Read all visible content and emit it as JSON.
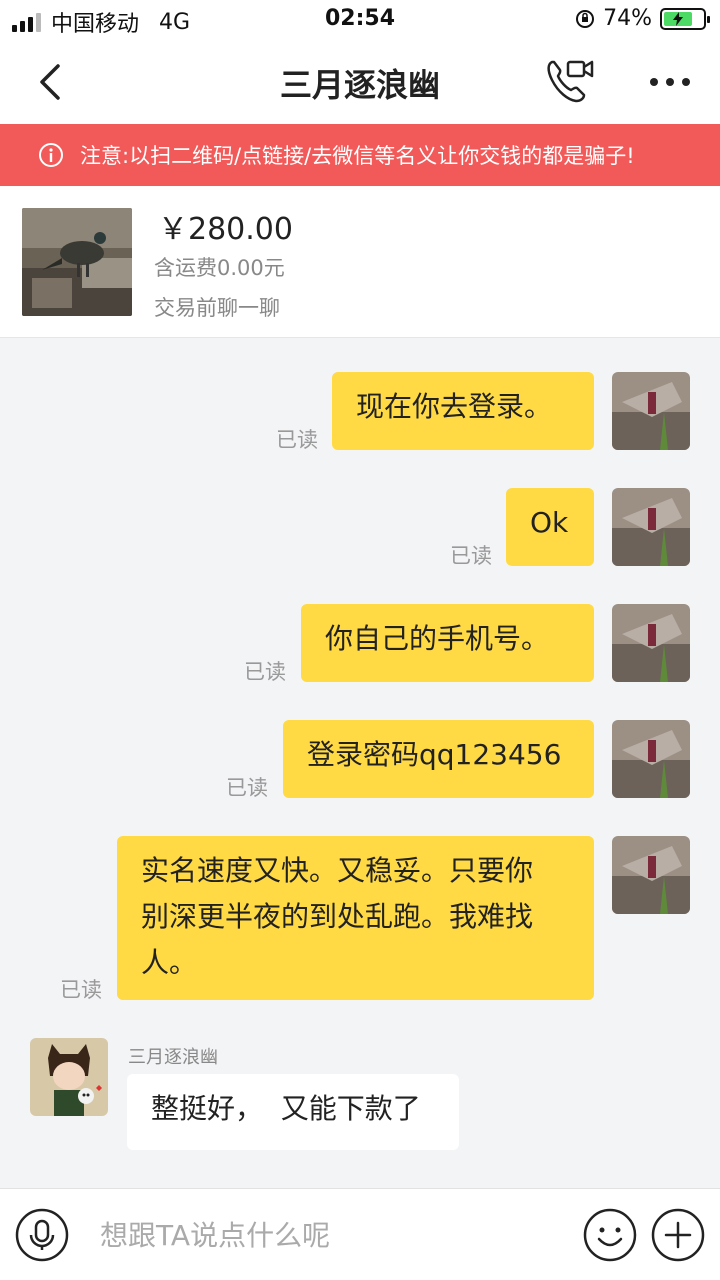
{
  "status_bar": {
    "carrier": "中国移动",
    "network": "4G",
    "time": "02:54",
    "battery": "74%",
    "battery_level": 0.74
  },
  "header": {
    "title": "三月逐浪幽",
    "back_icon": "chevron-left-icon",
    "call_icon": "video-phone-icon",
    "more_icon": "more-dots-icon"
  },
  "warning": {
    "text": "注意:以扫二维码/点链接/去微信等名义让你交钱的都是骗子!",
    "color": "#f25a5a"
  },
  "product": {
    "price": "￥280.00",
    "shipping": "含运费0.00元",
    "note": "交易前聊一聊"
  },
  "messages": [
    {
      "side": "self",
      "text": "现在你去登录。",
      "status": "已读"
    },
    {
      "side": "self",
      "text": "Ok",
      "status": "已读"
    },
    {
      "side": "self",
      "text": "你自己的手机号。",
      "status": "已读"
    },
    {
      "side": "self",
      "text": "登录密码qq123456",
      "status": "已读"
    },
    {
      "side": "self",
      "text_lines": [
        "实名速度又快。又稳妥。只要你",
        "别深更半夜的到处乱跑。我难找",
        "人。"
      ],
      "status": "已读"
    },
    {
      "side": "other",
      "sender": "三月逐浪幽",
      "text": "整挺好，  又能下款了"
    }
  ],
  "input_bar": {
    "placeholder": "想跟TA说点什么呢",
    "mic_icon": "microphone-icon",
    "emoji_icon": "smiley-icon",
    "plus_icon": "plus-icon"
  },
  "colors": {
    "bubble_self": "#ffda44",
    "bubble_other": "#ffffff",
    "background": "#f3f4f6"
  }
}
